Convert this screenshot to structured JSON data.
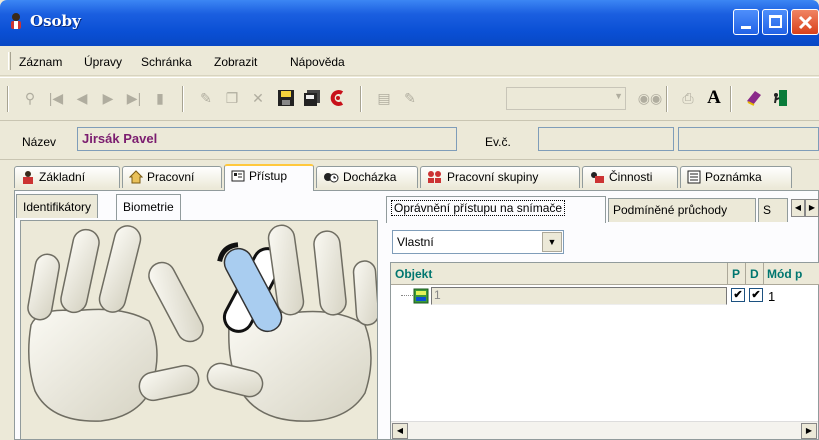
{
  "window": {
    "title": "Osoby"
  },
  "menu": [
    "Záznam",
    "Úpravy",
    "Schránka",
    "Zobrazit",
    "Nápověda"
  ],
  "toolbar": {
    "search_combo_value": ""
  },
  "record": {
    "name_label": "Název",
    "name_value": "Jirsák Pavel",
    "evc_label": "Ev.č.",
    "evc_value": "",
    "extra_value": ""
  },
  "main_tabs": [
    {
      "label": "Základní",
      "icon": "person-icon"
    },
    {
      "label": "Pracovní",
      "icon": "house-icon"
    },
    {
      "label": "Přístup",
      "icon": "card-icon",
      "active": true
    },
    {
      "label": "Docházka",
      "icon": "clock-person-icon"
    },
    {
      "label": "Pracovní skupiny",
      "icon": "group-icon"
    },
    {
      "label": "Činnosti",
      "icon": "tasks-icon"
    },
    {
      "label": "Poznámka",
      "icon": "note-icon"
    }
  ],
  "left_subtabs": [
    {
      "label": "Identifikátory"
    },
    {
      "label": "Biometrie",
      "active": true
    }
  ],
  "biometrics": {
    "highlighted_finger": "left-index",
    "highlight_color": "#a9cdf0"
  },
  "right_tabs": [
    {
      "label": "Oprávnění přístupu na snímače",
      "active": true
    },
    {
      "label": "Podmíněné průchody"
    },
    {
      "label": "S"
    }
  ],
  "access_mode_select": {
    "value": "Vlastní"
  },
  "grid": {
    "columns": [
      "Objekt",
      "P",
      "D",
      "Mód p"
    ],
    "rows": [
      {
        "objekt": "1",
        "p": "✔",
        "d": "✔",
        "mod": "1"
      }
    ]
  },
  "colors": {
    "title_bar": "#0a4fd4",
    "name_text": "#7b1d6f",
    "grid_header": "#00766f",
    "active_tab_accent": "#ffc83c"
  }
}
